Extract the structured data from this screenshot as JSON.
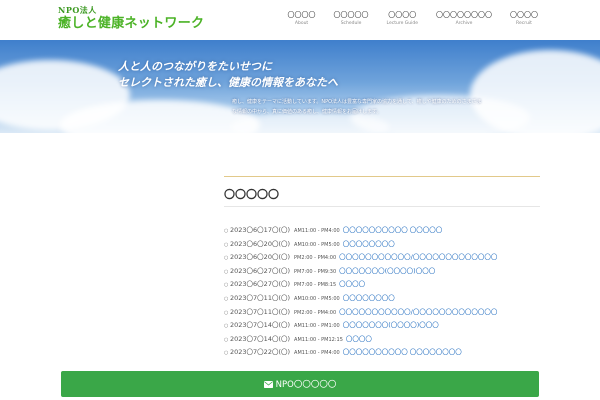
{
  "header": {
    "logo_sub": "NPO法人",
    "logo_main": "癒しと健康ネットワーク",
    "nav": [
      {
        "jp": "〇〇〇〇",
        "en": "About"
      },
      {
        "jp": "〇〇〇〇〇",
        "en": "Schedule"
      },
      {
        "jp": "〇〇〇〇",
        "en": "Lecture Guide"
      },
      {
        "jp": "〇〇〇〇〇〇〇〇",
        "en": "Archive"
      },
      {
        "jp": "〇〇〇〇",
        "en": "Recruit"
      }
    ]
  },
  "hero": {
    "line1": "人と人のつながりをたいせつに",
    "line2": "セレクトされた癒し、健康の情報をあなたへ",
    "desc": "癒し、健康をテーマに活動しています。NPO法人は豊富な専門家の協力を通して、癒しや健康のためのさまざまな情報の中から、真に価値のある癒し、健康情報をお届けします。"
  },
  "main": {
    "section_title": "〇〇〇〇〇",
    "events": [
      {
        "date": "2023〇6〇17〇(〇)",
        "time": "AM11:00 - PM4:00",
        "title": "〇〇〇〇〇〇〇〇〇〇 〇〇〇〇〇"
      },
      {
        "date": "2023〇6〇20〇(〇)",
        "time": "AM10:00 - PM5:00",
        "title": "〇〇〇〇〇〇〇〇"
      },
      {
        "date": "2023〇6〇20〇(〇)",
        "time": "PM2:00 - PM4:00",
        "title": "〇〇〇〇〇〇〇〇〇〇〇/〇〇〇〇〇〇〇〇〇〇〇〇〇"
      },
      {
        "date": "2023〇6〇27〇(〇)",
        "time": "PM7:00 - PM9:30",
        "title": "〇〇〇〇〇〇〇(〇〇〇〇)〇〇〇"
      },
      {
        "date": "2023〇6〇27〇(〇)",
        "time": "PM7:00 - PM8:15",
        "title": "〇〇〇〇"
      },
      {
        "date": "2023〇7〇11〇(〇)",
        "time": "AM10:00 - PM5:00",
        "title": "〇〇〇〇〇〇〇〇"
      },
      {
        "date": "2023〇7〇11〇(〇)",
        "time": "PM2:00 - PM4:00",
        "title": "〇〇〇〇〇〇〇〇〇〇〇/〇〇〇〇〇〇〇〇〇〇〇〇〇"
      },
      {
        "date": "2023〇7〇14〇(〇)",
        "time": "AM11:00 - PM1:00",
        "title": "〇〇〇〇〇〇〇(〇〇〇〇)〇〇〇"
      },
      {
        "date": "2023〇7〇14〇(〇)",
        "time": "AM11:00 - PM12:15",
        "title": "〇〇〇〇"
      },
      {
        "date": "2023〇7〇22〇(〇)",
        "time": "AM11:00 - PM4:00",
        "title": "〇〇〇〇〇〇〇〇〇〇 〇〇〇〇〇〇〇〇"
      }
    ]
  },
  "bottom_button": {
    "icon": "envelope-icon",
    "label": "NPO〇〇〇〇〇"
  },
  "colors": {
    "brand_green": "#4cb327",
    "button_green": "#3aa748",
    "link_blue": "#2b73c2",
    "accent_gold": "#e2c98a"
  }
}
